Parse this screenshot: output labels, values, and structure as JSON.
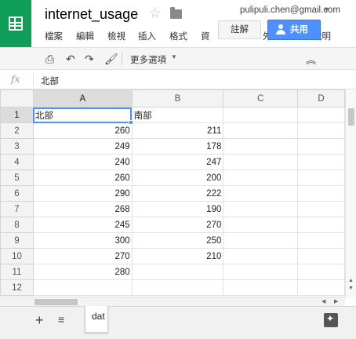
{
  "app": {
    "title": "internet_usage",
    "account": "pulipuli.chen@gmail.com"
  },
  "menu": [
    "檔案",
    "編輯",
    "檢視",
    "插入",
    "格式",
    "資",
    "外",
    "說明"
  ],
  "buttons": {
    "comments": "註解",
    "share": "共用"
  },
  "toolbar": {
    "more": "更多選項"
  },
  "formula_bar": {
    "fx": "fx",
    "value": "北部"
  },
  "columns": [
    "A",
    "B",
    "C",
    "D"
  ],
  "rows": [
    {
      "n": "1",
      "a": "北部",
      "b": "南部"
    },
    {
      "n": "2",
      "a": "260",
      "b": "211"
    },
    {
      "n": "3",
      "a": "249",
      "b": "178"
    },
    {
      "n": "4",
      "a": "240",
      "b": "247"
    },
    {
      "n": "5",
      "a": "260",
      "b": "200"
    },
    {
      "n": "6",
      "a": "290",
      "b": "222"
    },
    {
      "n": "7",
      "a": "268",
      "b": "190"
    },
    {
      "n": "8",
      "a": "245",
      "b": "270"
    },
    {
      "n": "9",
      "a": "300",
      "b": "250"
    },
    {
      "n": "10",
      "a": "270",
      "b": "210"
    },
    {
      "n": "11",
      "a": "280",
      "b": ""
    },
    {
      "n": "12",
      "a": "",
      "b": ""
    }
  ],
  "sheets": [
    {
      "label": "dat"
    }
  ],
  "colors": {
    "brand": "#0f9d58",
    "share": "#4d90fe",
    "selection": "#4d90fe"
  },
  "icons": [
    "sheets-logo-icon",
    "star-icon",
    "folder-icon",
    "print-icon",
    "undo-icon",
    "redo-icon",
    "paint-format-icon",
    "collapse-icon",
    "fx-icon",
    "explore-icon"
  ]
}
